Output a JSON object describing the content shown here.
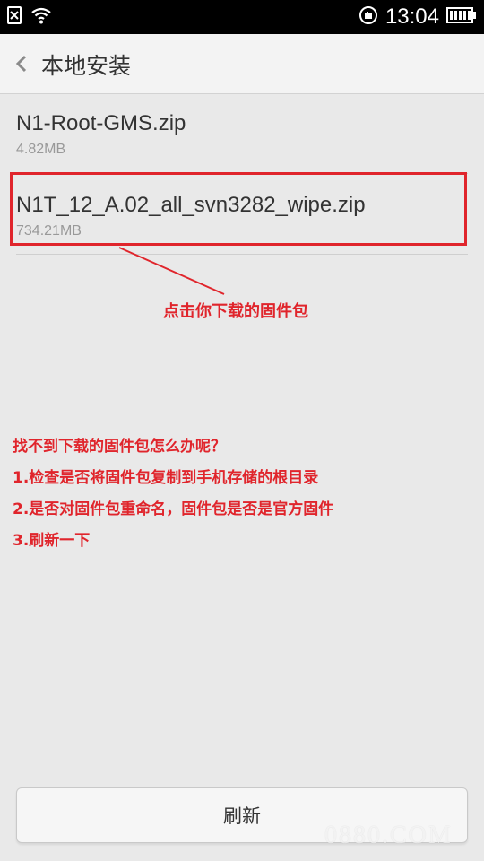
{
  "status_bar": {
    "time": "13:04",
    "icons": [
      "sim-off-icon",
      "wifi-icon",
      "alarm-icon",
      "battery-icon"
    ]
  },
  "action_bar": {
    "back_icon": "chevron-left-icon",
    "title": "本地安装"
  },
  "files": [
    {
      "name": "N1-Root-GMS.zip",
      "size": "4.82MB"
    },
    {
      "name": "N1T_12_A.02_all_svn3282_wipe.zip",
      "size": "734.21MB"
    }
  ],
  "annotation": {
    "label": "点击你下载的固件包",
    "color": "#e0252c"
  },
  "faq": [
    "找不到下载的固件包怎么办呢？",
    "1.检查是否将固件包复制到手机存储的根目录",
    "2.是否对固件包重命名，固件包是否是官方固件",
    "3.刷新一下"
  ],
  "refresh_button": {
    "label": "刷新"
  },
  "watermark": "0880.COM"
}
